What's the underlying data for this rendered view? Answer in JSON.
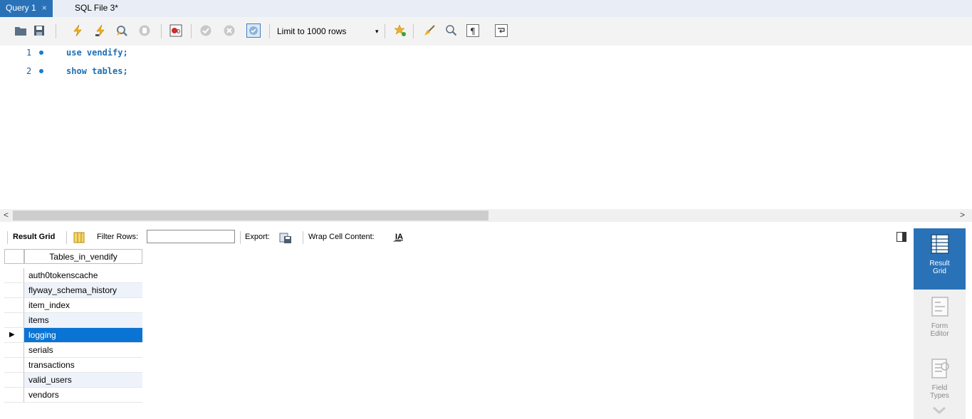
{
  "tabs": [
    {
      "label": "Query 1",
      "close": "×",
      "active": true
    },
    {
      "label": "SQL File 3*",
      "active": false
    }
  ],
  "toolbar": {
    "limit_select": "Limit to 1000 rows",
    "limit_arrow": "▾"
  },
  "editor": {
    "lines": [
      {
        "number": "1",
        "code": "use vendify;"
      },
      {
        "number": "2",
        "code": "show tables;"
      }
    ]
  },
  "scroll": {
    "left": "<",
    "right": ">"
  },
  "result_toolbar": {
    "result_grid": "Result Grid",
    "filter_rows": "Filter Rows:",
    "filter_value": "",
    "export": "Export:",
    "wrap": "Wrap Cell Content:",
    "wrap_icon": "I͟A"
  },
  "grid": {
    "column": "Tables_in_vendify",
    "rows": [
      "auth0tokenscache",
      "flyway_schema_history",
      "item_index",
      "items",
      "logging",
      "serials",
      "transactions",
      "valid_users",
      "vendors"
    ],
    "selected_marker": "▶"
  },
  "side_panel": {
    "result_grid_line1": "Result",
    "result_grid_line2": "Grid",
    "form_editor_line1": "Form",
    "form_editor_line2": "Editor",
    "field_types_line1": "Field",
    "field_types_line2": "Types"
  },
  "colors": {
    "accent": "#2a72b8",
    "selection": "#0a74d4"
  }
}
